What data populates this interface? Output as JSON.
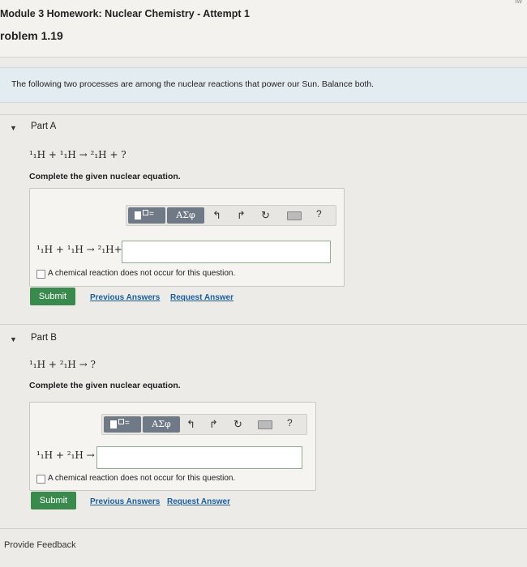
{
  "header": {
    "module_title": "Module 3 Homework: Nuclear Chemistry - Attempt 1",
    "problem_title": "roblem 1.19",
    "corner_text": "Iw"
  },
  "intro": "The following two processes are among the nuclear reactions that power our Sun. Balance both.",
  "part_a": {
    "toggle": "▼",
    "title": "Part A",
    "equation": "¹₁H + ¹₁H → ²₁H + ?",
    "instruction": "Complete the given nuclear equation.",
    "answer_prefix": "¹₁H + ¹₁H → ²₁H+",
    "input_value": "",
    "checkbox_label": "A chemical reaction does not occur for this question.",
    "submit": "Submit",
    "previous_answers": "Previous Answers",
    "request_answer": "Request Answer"
  },
  "part_b": {
    "toggle": "▼",
    "title": "Part B",
    "equation": "¹₁H + ²₁H → ?",
    "instruction": "Complete the given nuclear equation.",
    "answer_prefix": "¹₁H + ²₁H →",
    "input_value": "",
    "checkbox_label": "A chemical reaction does not occur for this question.",
    "submit": "Submit",
    "previous_answers": "Previous Answers",
    "request_answer": "Request Answer"
  },
  "toolbar": {
    "template_label": "=",
    "greek_label": "ΑΣφ",
    "undo": "↰",
    "redo": "↱",
    "reset": "↻",
    "help": "?"
  },
  "feedback": "Provide Feedback",
  "colors": {
    "submit_bg": "#3a8a4e",
    "link": "#1d5d9a",
    "intro_bg": "#e3ecf0",
    "toolbar_button": "#707a86"
  }
}
